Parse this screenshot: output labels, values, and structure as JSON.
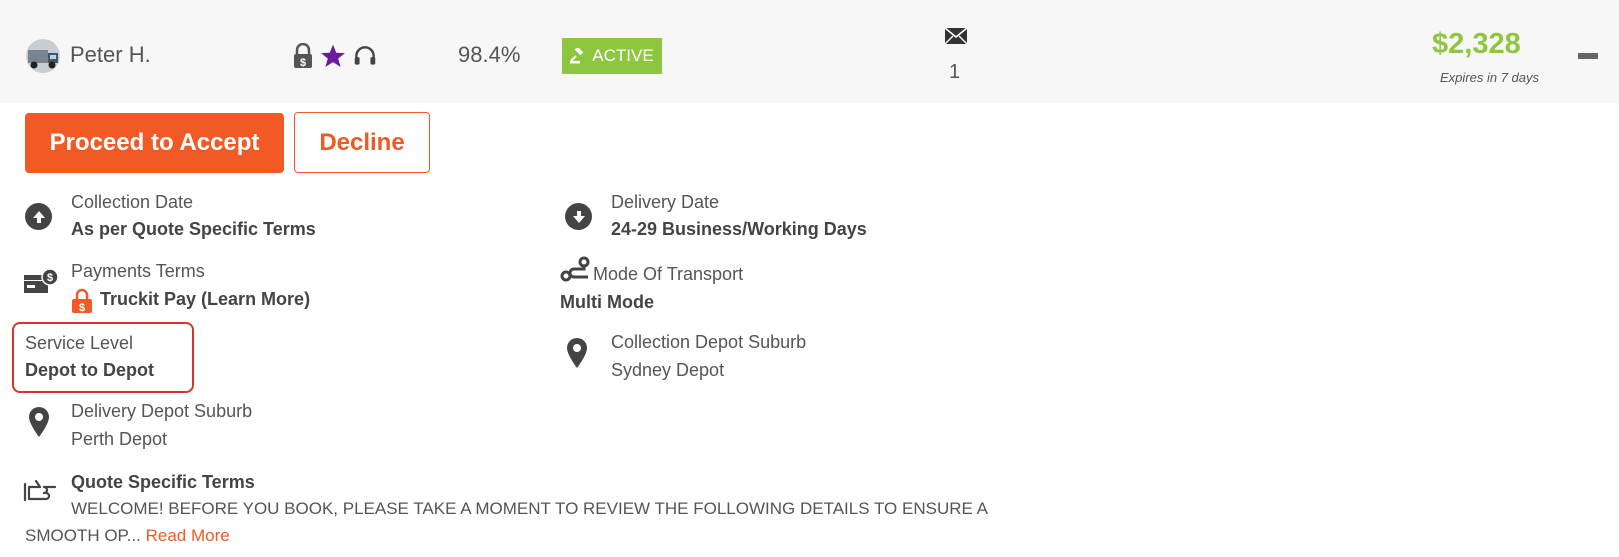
{
  "carrier": {
    "name": "Peter H.",
    "rating": "98.4%",
    "status": "ACTIVE",
    "message_count": "1",
    "icons": [
      "truck-avatar",
      "secure-pay-lock-icon",
      "star-icon",
      "headset-icon",
      "gavel-icon",
      "envelope-icon"
    ]
  },
  "quote": {
    "price": "$2,328",
    "expires": "Expires in 7 days"
  },
  "actions": {
    "accept_label": "Proceed to Accept",
    "decline_label": "Decline"
  },
  "details": {
    "collection_date_label": "Collection Date",
    "collection_date_value": "As per Quote Specific Terms",
    "delivery_date_label": "Delivery Date",
    "delivery_date_value": "24-29 Business/Working Days",
    "payment_terms_label": "Payments Terms",
    "payment_terms_value": "Truckit Pay (Learn More)",
    "mode_label": "Mode Of Transport",
    "mode_value": "Multi Mode",
    "service_level_label": "Service Level",
    "service_level_value": "Depot to Depot",
    "collection_depot_label": "Collection Depot Suburb",
    "collection_depot_value": "Sydney Depot",
    "delivery_depot_label": "Delivery Depot Suburb",
    "delivery_depot_value": "Perth Depot"
  },
  "terms": {
    "heading": "Quote Specific Terms",
    "line1": "WELCOME! BEFORE YOU BOOK, PLEASE TAKE A MOMENT TO REVIEW THE FOLLOWING DETAILS TO ENSURE A",
    "line2": "SMOOTH OP...",
    "read_more": "Read More"
  },
  "colors": {
    "accent": "#f15a24",
    "price": "#8dc63f",
    "badge": "#8dc63f",
    "highlight_box": "#d9342b",
    "star": "#6a1b9a"
  }
}
